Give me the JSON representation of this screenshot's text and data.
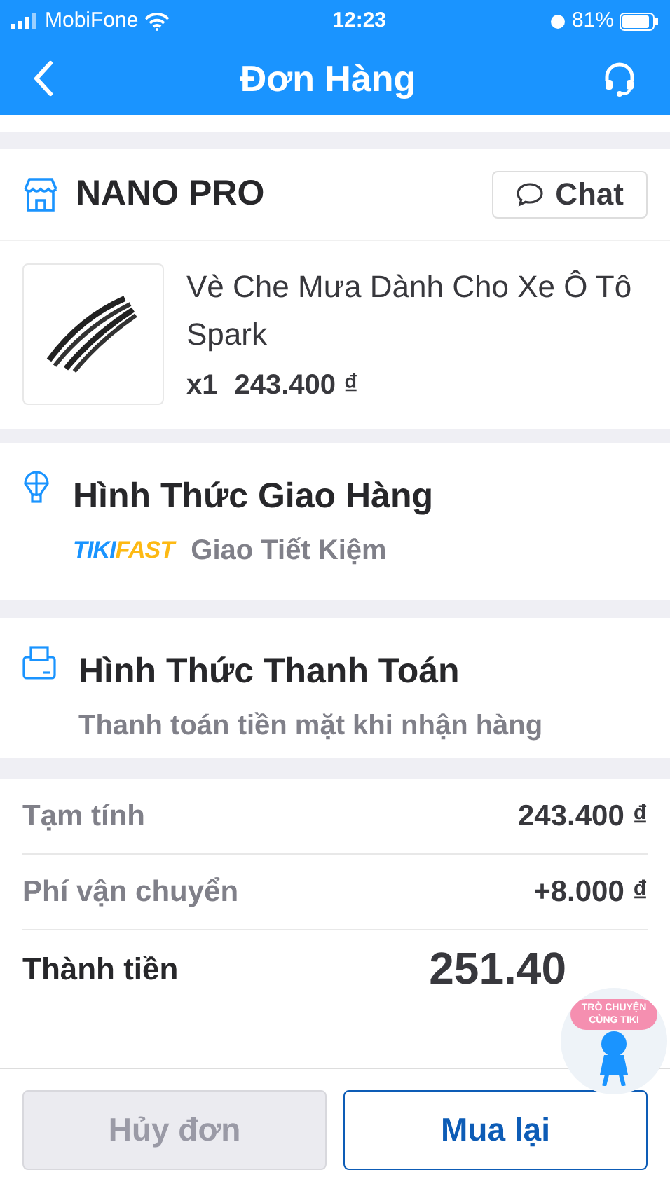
{
  "status_bar": {
    "carrier": "MobiFone",
    "time": "12:23",
    "battery": "81%"
  },
  "header": {
    "title": "Đơn Hàng"
  },
  "shop": {
    "name": "NANO PRO",
    "chat_button": "Chat"
  },
  "product": {
    "name": "Vè Che Mưa Dành Cho Xe Ô Tô  Spark",
    "quantity": "x1",
    "price": "243.400 ₫"
  },
  "shipping": {
    "title": "Hình Thức Giao Hàng",
    "badge_parts": [
      "TIKI",
      "FAST"
    ],
    "method": "Giao Tiết Kiệm"
  },
  "payment": {
    "title": "Hình Thức Thanh Toán",
    "method": "Thanh toán tiền mặt khi nhận hàng"
  },
  "summary": [
    {
      "kind": "line",
      "label": "Tạm tính",
      "value": "243.400 ₫"
    },
    {
      "kind": "line",
      "label": "Phí vận chuyển",
      "value": "+8.000 ₫"
    },
    {
      "kind": "total",
      "label": "Thành tiền",
      "value": "251.40"
    }
  ],
  "floating_chat": {
    "label": "TRÒ CHUYỆN CÙNG TIKI"
  },
  "buttons": [
    {
      "label": "Hủy đơn",
      "disabled": true
    },
    {
      "label": "Mua lại",
      "disabled": false
    }
  ]
}
